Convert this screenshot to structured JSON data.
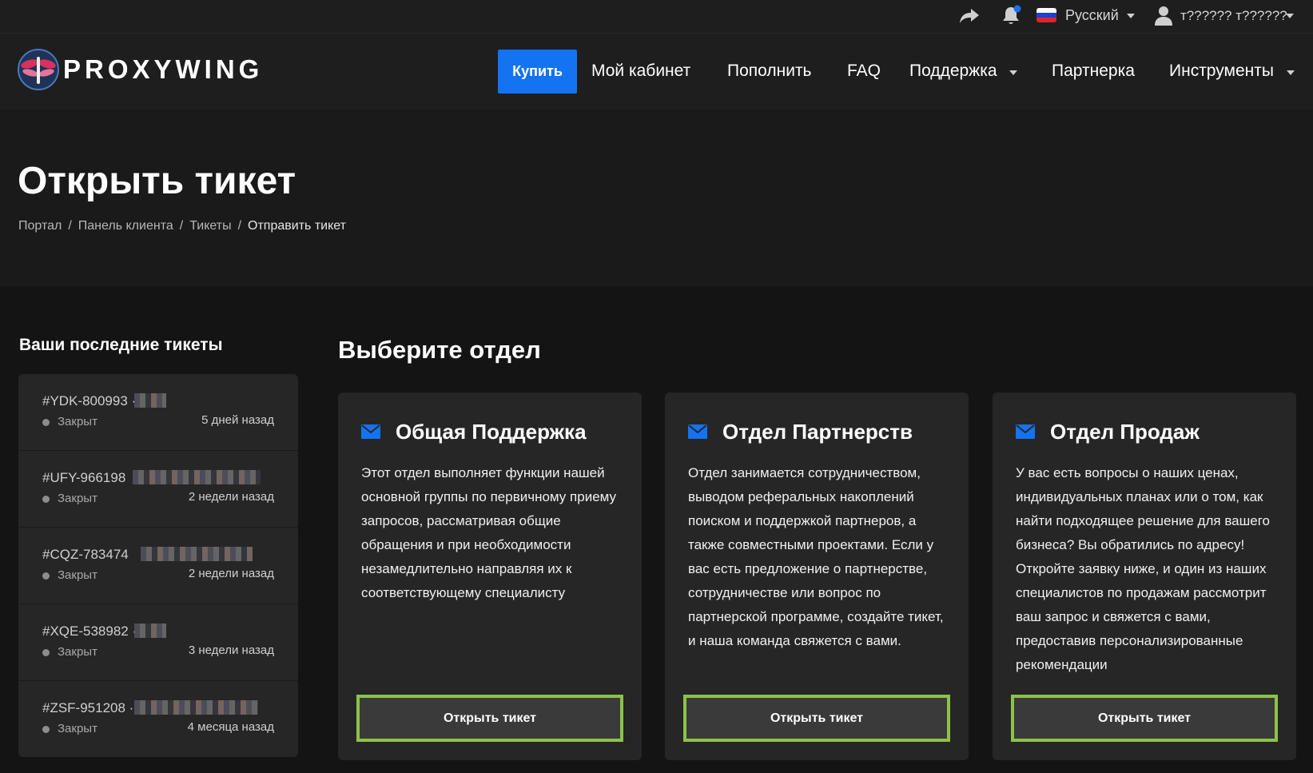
{
  "topbar": {
    "language": "Русский",
    "user_name": "т?????? т??????"
  },
  "brand": {
    "logo_text": "PROXYWING",
    "accent": "#1473f1",
    "highlight": "#8bc34a"
  },
  "nav": {
    "buy": "Купить",
    "cabinet": "Мой кабинет",
    "topup": "Пополнить",
    "faq": "FAQ",
    "support": "Поддержка",
    "partner": "Партнерка",
    "tools": "Инструменты"
  },
  "hero": {
    "title": "Открыть тикет",
    "breadcrumb": [
      "Портал",
      "Панель клиента",
      "Тикеты",
      "Отправить тикет"
    ],
    "separator": "/"
  },
  "sidebar": {
    "title": "Ваши последние тикеты",
    "tickets": [
      {
        "id": "#YDK-800993 ·",
        "status": "Закрыт",
        "time": "5 дней назад"
      },
      {
        "id": "#UFY-966198",
        "status": "Закрыт",
        "time": "2 недели назад"
      },
      {
        "id": "#CQZ-783474",
        "status": "Закрыт",
        "time": "2 недели назад"
      },
      {
        "id": "#XQE-538982 ·",
        "status": "Закрыт",
        "time": "3 недели назад"
      },
      {
        "id": "#ZSF-951208 ·",
        "status": "Закрыт",
        "time": "4 месяца назад"
      }
    ]
  },
  "departments": {
    "heading": "Выберите отдел",
    "items": [
      {
        "title": "Общая Поддержка",
        "description": "Этот отдел выполняет функции нашей основной группы по первичному приему запросов, рассматривая общие обращения и при необходимости незамедлительно направляя их к соответствующему специалисту",
        "button": "Открыть тикет"
      },
      {
        "title": "Отдел Партнерств",
        "description": "Отдел занимается сотрудничеством, выводом реферальных накоплений поиском и поддержкой партнеров, а также совместными проектами. Если у вас есть предложение о партнерстве, сотрудничестве или вопрос по партнерской программе, создайте тикет, и наша команда свяжется с вами.",
        "button": "Открыть тикет"
      },
      {
        "title": "Отдел Продаж",
        "description": "У вас есть вопросы о наших ценах, индивидуальных планах или о том, как найти подходящее решение для вашего бизнеса? Вы обратились по адресу! Откройте заявку ниже, и один из наших специалистов по продажам рассмотрит ваш запрос и свяжется с вами, предоставив персонализированные рекомендации",
        "button": "Открыть тикет"
      }
    ]
  }
}
